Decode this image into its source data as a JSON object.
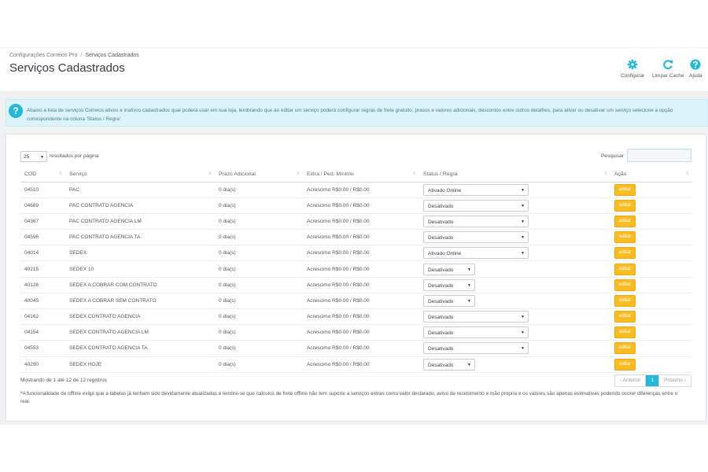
{
  "breadcrumb": {
    "parent": "Configurações Correios Pro",
    "separator": "/",
    "current": "Serviços Cadastrados"
  },
  "page_title": "Serviços Cadastrados",
  "toolbar": [
    {
      "label": "Configurar",
      "icon": "gear-icon"
    },
    {
      "label": "Limpar Cache",
      "icon": "refresh-icon"
    },
    {
      "label": "Ajuda",
      "icon": "help-icon"
    }
  ],
  "info": {
    "icon": "question-icon",
    "text": "Abaixo a lista de serviços Correios ativos e inativos cadastrados qual poderá usar em sua loja, lembrando que ao editar um serviço poderá configurar regras de frete gratuito, prasos e valores adicionais, descontos entre outros detalhes, para ativar ou desativar um serviço selecione a opção correspondente na coluna 'Status / Regra'."
  },
  "colors": {
    "accent": "#25b9d7",
    "edit_button": "#fbbb22"
  },
  "list": {
    "per_page_value": "25",
    "per_page_label": "resultados por página",
    "search_label": "Pesquisar",
    "search_value": "",
    "columns": [
      "COD",
      "Serviço",
      "Prazo Adicional",
      "Extra / Ped. Mínimo",
      "Status / Regra",
      "Ação"
    ],
    "edit_label": "editar",
    "rows": [
      {
        "cod": "04510",
        "servico": "PAC",
        "prazo": "0 dia(s)",
        "extra": "Acrescimo R$0.00 / R$0.00",
        "status": "Ativado Online",
        "select_width": "wide"
      },
      {
        "cod": "04669",
        "servico": "PAC CONTRATO AGENCIA",
        "prazo": "0 dia(s)",
        "extra": "Acrescimo R$0.00 / R$0.00",
        "status": "Desativado",
        "select_width": "wide"
      },
      {
        "cod": "04367",
        "servico": "PAC CONTRATO AGENCIA LM",
        "prazo": "0 dia(s)",
        "extra": "Acrescimo R$0.00 / R$0.00",
        "status": "Desativado",
        "select_width": "wide"
      },
      {
        "cod": "04596",
        "servico": "PAC CONTRATO AGENCIA TA",
        "prazo": "0 dia(s)",
        "extra": "Acrescimo R$0.00 / R$0.00",
        "status": "Desativado",
        "select_width": "wide"
      },
      {
        "cod": "04014",
        "servico": "SEDEX",
        "prazo": "0 dia(s)",
        "extra": "Acrescimo R$0.00 / R$0.00",
        "status": "Ativado Online",
        "select_width": "wide"
      },
      {
        "cod": "40215",
        "servico": "SEDEX 10",
        "prazo": "0 dia(s)",
        "extra": "Acrescimo R$0.00 / R$0.00",
        "status": "Desativado",
        "select_width": "narrow"
      },
      {
        "cod": "40126",
        "servico": "SEDEX A COBRAR COM CONTRATO",
        "prazo": "0 dia(s)",
        "extra": "Acrescimo R$0.00 / R$0.00",
        "status": "Desativado",
        "select_width": "narrow"
      },
      {
        "cod": "40045",
        "servico": "SEDEX A COBRAR SEM CONTRATO",
        "prazo": "0 dia(s)",
        "extra": "Acrescimo R$0.00 / R$0.00",
        "status": "Desativado",
        "select_width": "narrow"
      },
      {
        "cod": "04162",
        "servico": "SEDEX CONTRATO AGENCIA",
        "prazo": "0 dia(s)",
        "extra": "Acrescimo R$0.00 / R$0.00",
        "status": "Desativado",
        "select_width": "wide"
      },
      {
        "cod": "04154",
        "servico": "SEDEX CONTRATO AGENCIA LM",
        "prazo": "0 dia(s)",
        "extra": "Acrescimo R$0.00 / R$0.00",
        "status": "Desativado",
        "select_width": "wide"
      },
      {
        "cod": "04553",
        "servico": "SEDEX CONTRATO AGENCIA TA",
        "prazo": "0 dia(s)",
        "extra": "Acrescimo R$0.00 / R$0.00",
        "status": "Desativado",
        "select_width": "wide"
      },
      {
        "cod": "40290",
        "servico": "SEDEX HOJE",
        "prazo": "0 dia(s)",
        "extra": "Acrescimo R$0.00 / R$0.00",
        "status": "Desativado",
        "select_width": "narrow"
      }
    ],
    "showing_text": "Mostrando de 1 até 12 de 12 registros",
    "pagination": {
      "prev": "Anterior",
      "current": "1",
      "next": "Próximo"
    },
    "footnote": "*A funcionalidade de offline exige que a tabelas já tenham sido devidamente atualizadas e lembre-se que calculos de frete offline não tem suporte a serviços extras como valor declarado, aviso de recebimento e mão propria e os valores são apenas estimativas podendo ocorer diferenças entre o real."
  }
}
